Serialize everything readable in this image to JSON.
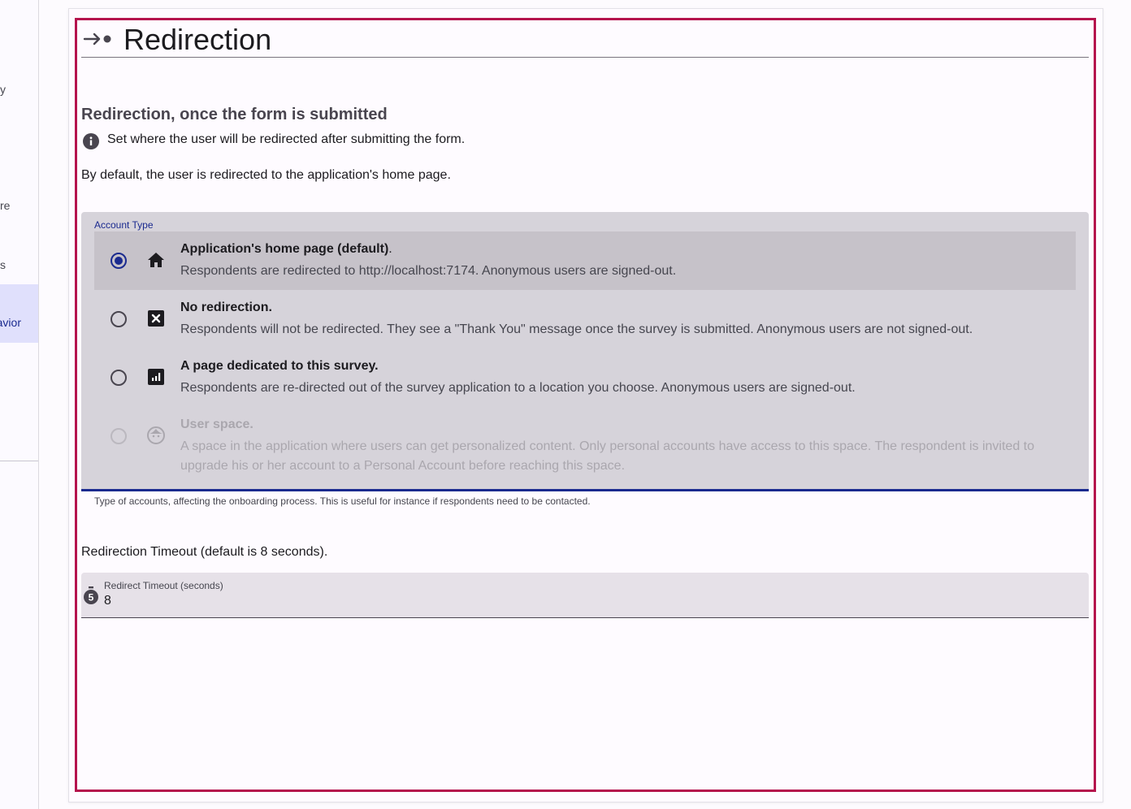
{
  "sidebar": {
    "items": [
      {
        "label": "y"
      },
      {
        "label": "re"
      },
      {
        "label": "s"
      },
      {
        "label": "avior"
      }
    ]
  },
  "header": {
    "title": "Redirection",
    "icon": "arrow-right-dot-icon"
  },
  "section": {
    "title": "Redirection, once the form is submitted",
    "info": "Set where the user will be redirected after submitting the form.",
    "default_note": "By default, the user is redirected to the application's home page."
  },
  "account_type": {
    "label": "Account Type",
    "options": [
      {
        "title": "Application's home page (default)",
        "title_suffix": ".",
        "description": "Respondents are redirected to http://localhost:7174. Anonymous users are signed-out.",
        "icon": "home-icon",
        "selected": true,
        "disabled": false
      },
      {
        "title": "No redirection.",
        "title_suffix": "",
        "description": "Respondents will not be redirected. They see a \"Thank You\" message once the survey is submitted. Anonymous users are not signed-out.",
        "icon": "close-box-icon",
        "selected": false,
        "disabled": false
      },
      {
        "title": "A page dedicated to this survey.",
        "title_suffix": "",
        "description": "Respondents are re-directed out of the survey application to a location you choose. Anonymous users are signed-out.",
        "icon": "chart-box-icon",
        "selected": false,
        "disabled": false
      },
      {
        "title": "User space.",
        "title_suffix": "",
        "description": "A space in the application where users can get personalized content. Only personal accounts have access to this space. The respondent is invited to upgrade his or her account to a Personal Account before reaching this space.",
        "icon": "face-icon",
        "selected": false,
        "disabled": true
      }
    ],
    "helper": "Type of accounts, affecting the onboarding process. This is useful for instance if respondents need to be contacted."
  },
  "timeout": {
    "label": "Redirection Timeout (default is 8 seconds).",
    "field_label": "Redirect Timeout (seconds)",
    "value": "8",
    "icon": "timer-5-icon"
  },
  "colors": {
    "accent": "#1a2a8f",
    "frame": "#b5134d"
  }
}
